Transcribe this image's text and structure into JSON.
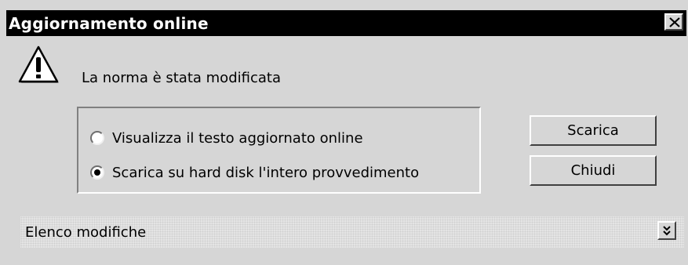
{
  "window": {
    "title": "Aggiornamento online"
  },
  "icons": {
    "warning": "warning-icon",
    "close": "close-icon",
    "expand": "double-chevron-down-icon"
  },
  "message": "La norma è stata modificata",
  "options": [
    {
      "label": "Visualizza il testo aggiornato online",
      "selected": false
    },
    {
      "label": "Scarica su hard disk l'intero provvedimento",
      "selected": true
    }
  ],
  "buttons": {
    "download": "Scarica",
    "close": "Chiudi"
  },
  "changes_panel": {
    "label": "Elenco modifiche",
    "expanded": false
  },
  "colors": {
    "title_bar": "#000000",
    "dialog_face": "#d6d6d6"
  }
}
